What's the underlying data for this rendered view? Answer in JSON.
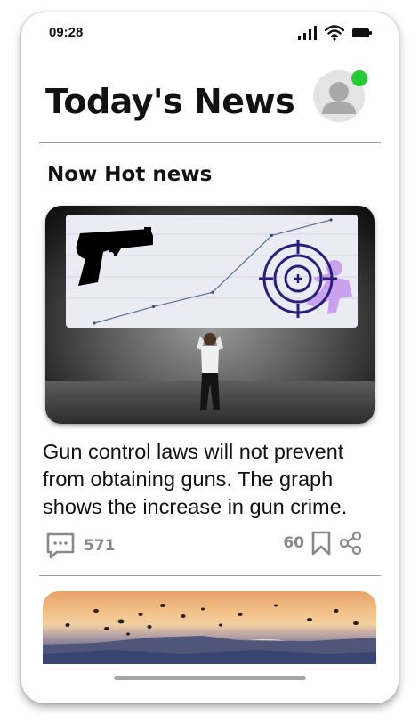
{
  "status_bar": {
    "time": "09:28"
  },
  "header": {
    "title": "Today's News"
  },
  "section": {
    "title": "Now Hot news"
  },
  "article": {
    "headline": "Gun control laws will not prevent from obtaining guns. The graph shows the increase in gun crime.",
    "comment_count": "571",
    "bookmark_count": "60",
    "graph_values": [
      0,
      0.16,
      0.3,
      0.85,
      1
    ]
  },
  "icons": {
    "signal": "signal-icon",
    "wifi": "wifi-icon",
    "battery": "battery-icon",
    "avatar": "user-avatar-icon",
    "comment": "comment-icon",
    "bookmark": "bookmark-icon",
    "share": "share-icon"
  },
  "colors": {
    "online": "#22cc33",
    "target": "#2a1e7a",
    "runner": "#c9a2ee",
    "meta": "#888888"
  }
}
